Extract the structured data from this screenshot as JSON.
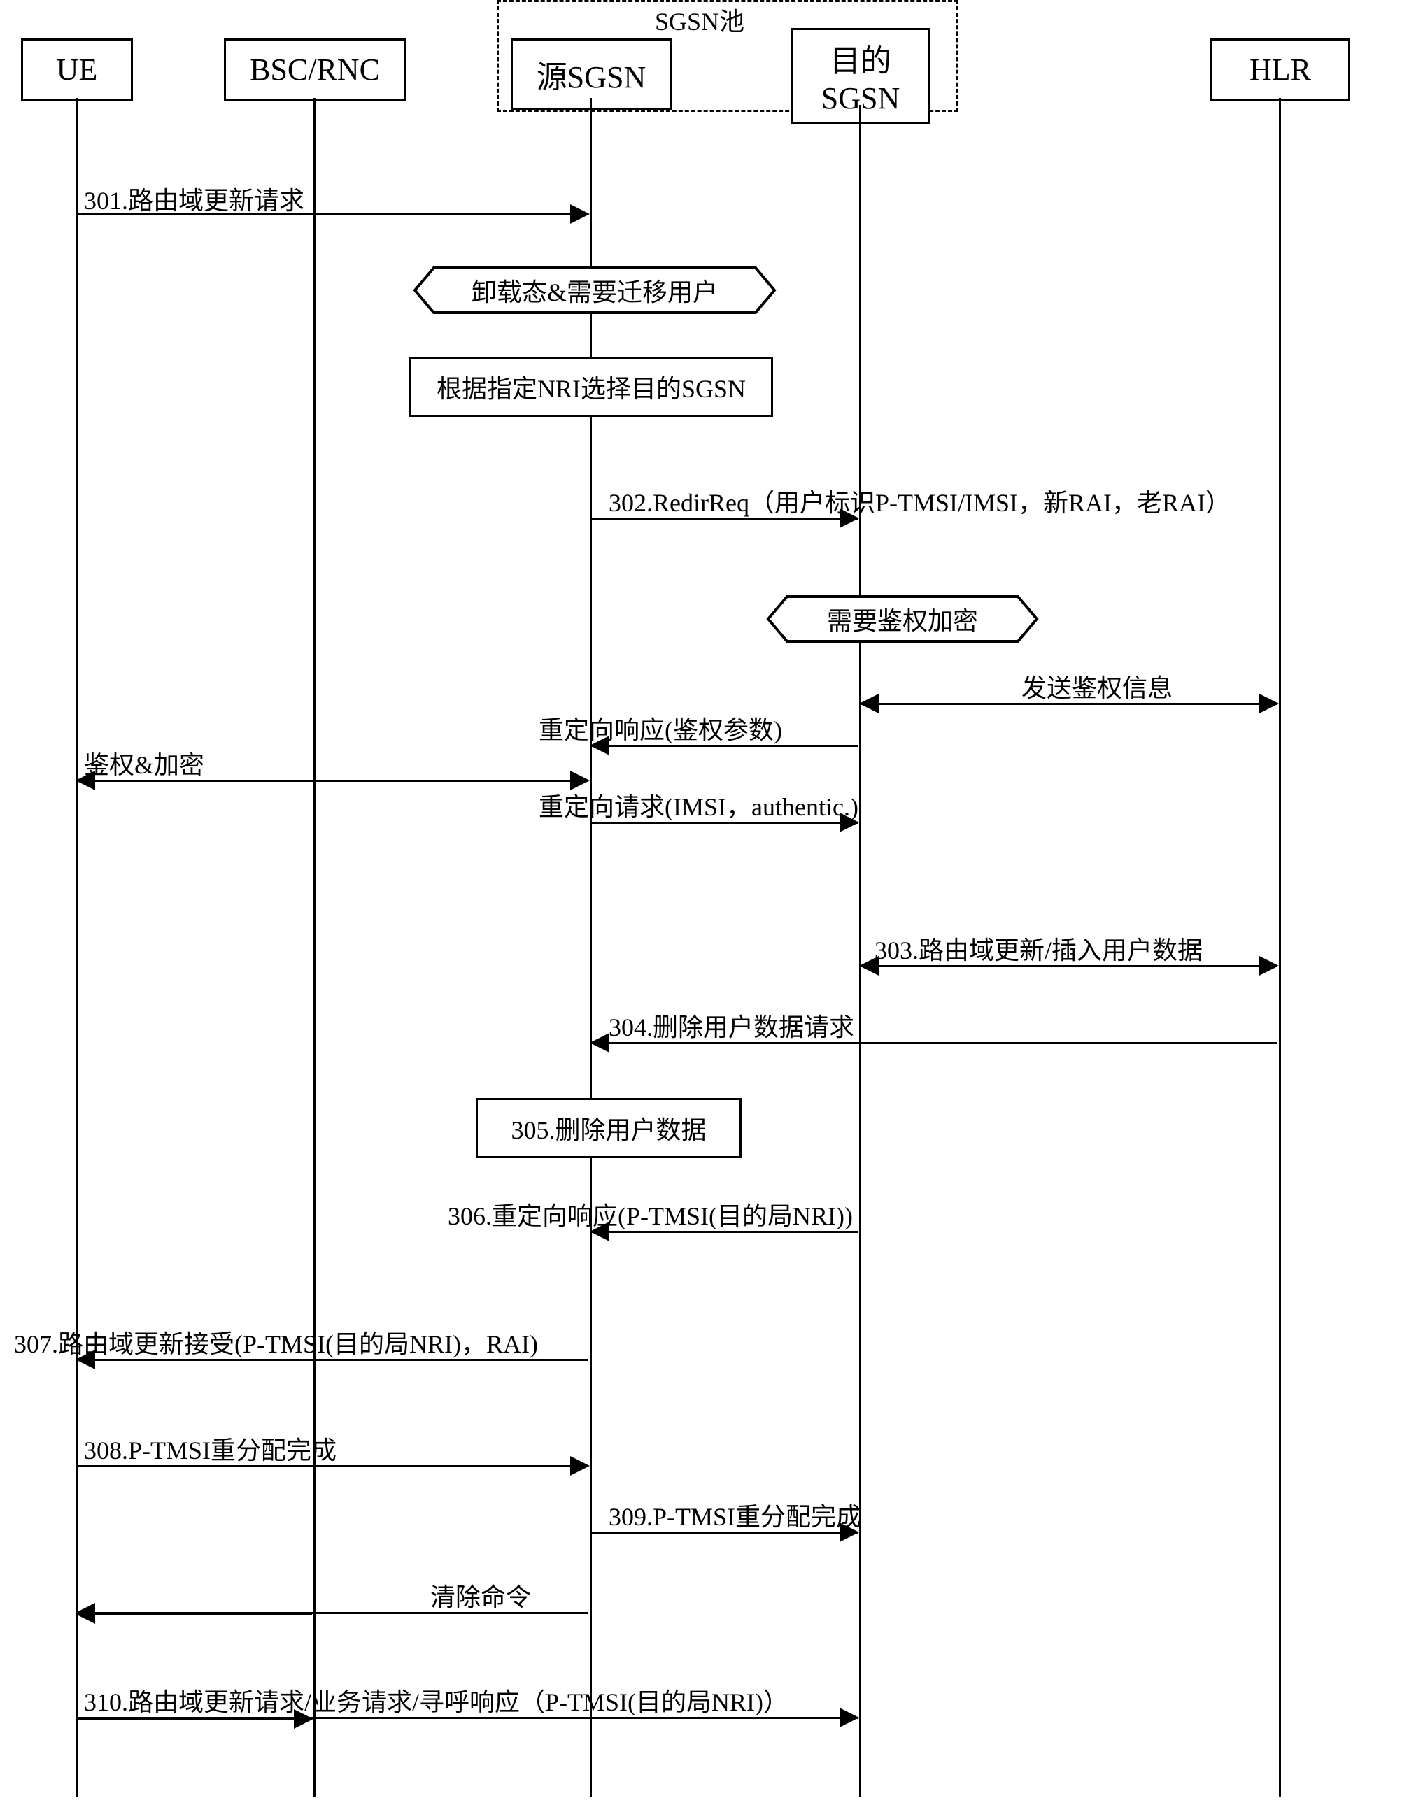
{
  "pool_label": "SGSN池",
  "participants": {
    "ue": "UE",
    "bsc": "BSC/RNC",
    "src_sgsn": "源SGSN",
    "dst_sgsn": "目的\nSGSN",
    "hlr": "HLR"
  },
  "conditions": {
    "offload": "卸载态&需要迁移用户",
    "auth_needed": "需要鉴权加密"
  },
  "actions": {
    "select_dst": "根据指定NRI选择目的SGSN",
    "delete_user": "305.删除用户数据"
  },
  "messages": {
    "m301": "301.路由域更新请求",
    "m302": "302.RedirReq（用户标识P-TMSI/IMSI，新RAI，老RAI）",
    "send_auth": "发送鉴权信息",
    "redir_resp_auth": "重定向响应(鉴权参数)",
    "auth_enc": "鉴权&加密",
    "redir_req_imsi": "重定向请求(IMSI，authentic.)",
    "m303": "303.路由域更新/插入用户数据",
    "m304": "304.删除用户数据请求",
    "m306": "306.重定向响应(P-TMSI(目的局NRI))",
    "m307": "307.路由域更新接受(P-TMSI(目的局NRI)，RAI)",
    "m308": "308.P-TMSI重分配完成",
    "m309": "309.P-TMSI重分配完成",
    "clear_cmd": "清除命令",
    "m310": "310.路由域更新请求/业务请求/寻呼响应（P-TMSI(目的局NRI)）"
  }
}
